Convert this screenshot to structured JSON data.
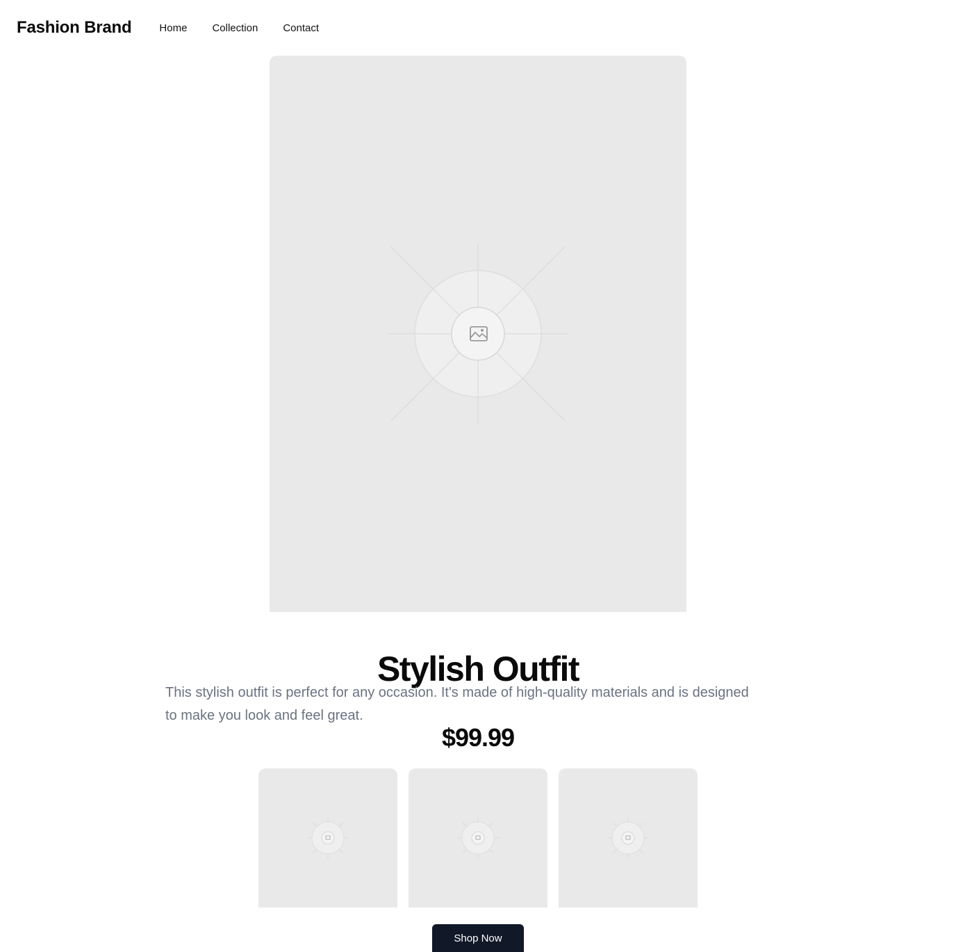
{
  "header": {
    "brand": "Fashion Brand",
    "nav": [
      {
        "label": "Home"
      },
      {
        "label": "Collection"
      },
      {
        "label": "Contact"
      }
    ]
  },
  "product": {
    "main_image_icon": "image-placeholder-icon",
    "title": "Stylish Outfit",
    "description": "This stylish outfit is perfect for any occasion. It's made of high-quality materials and is designed to make you look and feel great.",
    "price": "$99.99",
    "thumbnails_icon": "image-placeholder-icon"
  },
  "cta": {
    "label": "Shop Now"
  },
  "colors": {
    "placeholder_bg": "#e9e9e9",
    "button_bg": "#111827",
    "description_text": "#6b7280"
  }
}
